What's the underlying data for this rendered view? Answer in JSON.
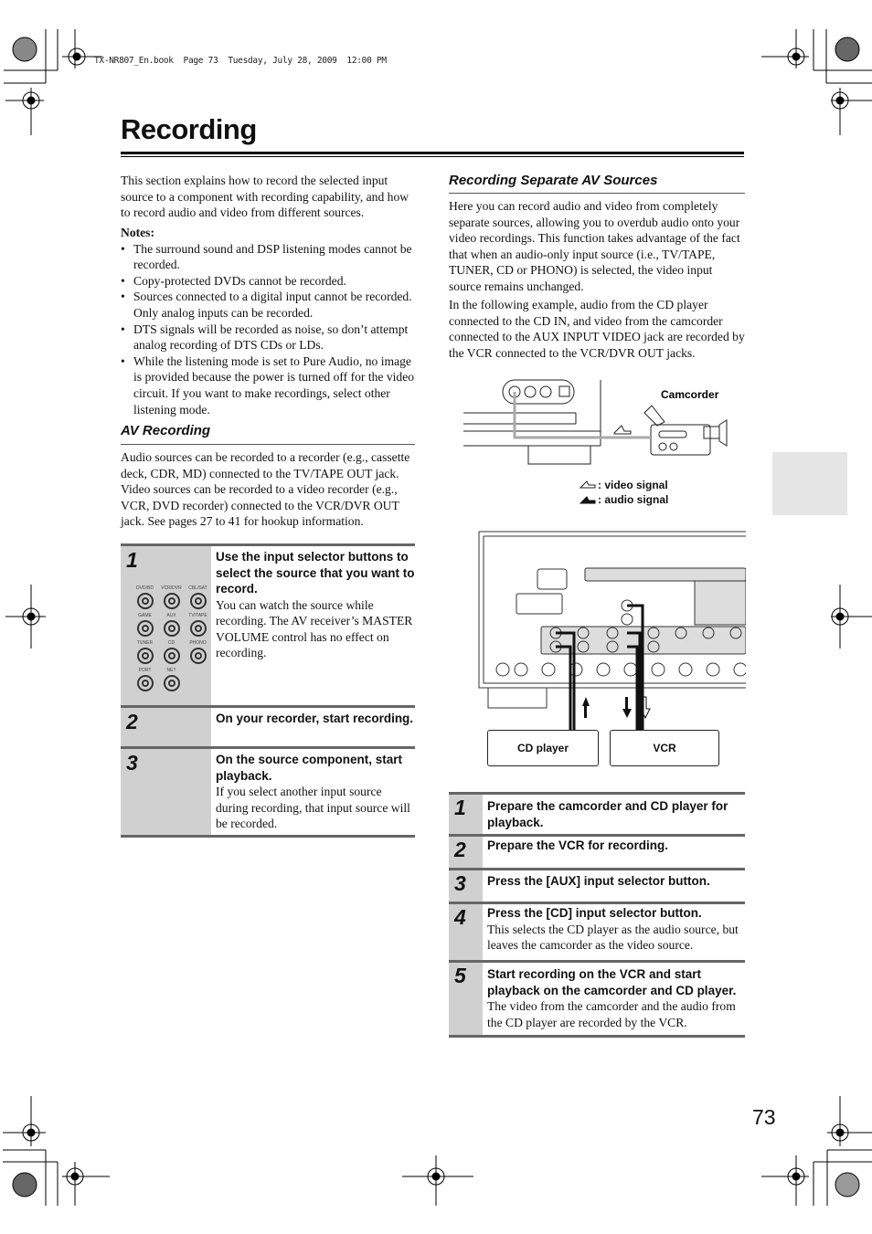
{
  "header": {
    "print_info": "TX-NR807_En.book  Page 73  Tuesday, July 28, 2009  12:00 PM"
  },
  "page": {
    "title": "Recording",
    "page_number": "73"
  },
  "left": {
    "intro": "This section explains how to record the selected input source to a component with recording capability, and how to record audio and video from different sources.",
    "notes_title": "Notes:",
    "notes": [
      "The surround sound and DSP listening modes cannot be recorded.",
      "Copy-protected DVDs cannot be recorded.",
      "Sources connected to a digital input cannot be recorded. Only analog inputs can be recorded.",
      "DTS signals will be recorded as noise, so don’t attempt analog recording of DTS CDs or LDs.",
      "While the listening mode is set to Pure Audio, no image is provided because the power is turned off for the video circuit. If you want to make recordings, select other listening mode."
    ],
    "av_recording": {
      "heading": "AV Recording",
      "body": "Audio sources can be recorded to a recorder (e.g., cassette deck, CDR, MD) connected to the TV/TAPE OUT jack. Video sources can be recorded to a video recorder (e.g., VCR, DVD recorder) connected to the VCR/DVR OUT jack. See pages 27 to 41 for hookup information."
    },
    "selector_buttons": [
      "DVD/BD",
      "VCR/DVR",
      "CBL/SAT",
      "GAME",
      "AUX",
      "TV/TAPE",
      "TUNER",
      "CD",
      "PHONO",
      "PORT",
      "NET"
    ],
    "steps": [
      {
        "num": "1",
        "title": "Use the input selector buttons to select the source that you want to record.",
        "body": "You can watch the source while recording. The AV receiver’s MASTER VOLUME control has no effect on recording."
      },
      {
        "num": "2",
        "title": "On your recorder, start recording.",
        "body": ""
      },
      {
        "num": "3",
        "title": "On the source component, start playback.",
        "body": "If you select another input source during recording, that input source will be recorded."
      }
    ]
  },
  "right": {
    "heading": "Recording Separate AV Sources",
    "para1": "Here you can record audio and video from completely separate sources, allowing you to overdub audio onto your video recordings. This function takes advantage of the fact that when an audio-only input source (i.e., TV/TAPE, TUNER, CD or PHONO) is selected, the video input source remains unchanged.",
    "para2": "In the following example, audio from the CD player connected to the CD IN, and video from the camcorder connected to the AUX INPUT VIDEO jack are recorded by the VCR connected to the VCR/DVR OUT jacks.",
    "diagram": {
      "camcorder_label": "Camcorder",
      "legend_video": ": video signal",
      "legend_audio": ": audio signal",
      "cd_player_label": "CD player",
      "vcr_label": "VCR"
    },
    "steps": [
      {
        "num": "1",
        "title": "Prepare the camcorder and CD player for playback.",
        "body": ""
      },
      {
        "num": "2",
        "title": "Prepare the VCR for recording.",
        "body": ""
      },
      {
        "num": "3",
        "title": "Press the [AUX] input selector button.",
        "body": ""
      },
      {
        "num": "4",
        "title": "Press the [CD] input selector button.",
        "body": "This selects the CD player as the audio source, but leaves the camcorder as the video source."
      },
      {
        "num": "5",
        "title": "Start recording on the VCR and start playback on the camcorder and CD player.",
        "body": "The video from the camcorder and the audio from the CD player are recorded by the VCR."
      }
    ]
  }
}
